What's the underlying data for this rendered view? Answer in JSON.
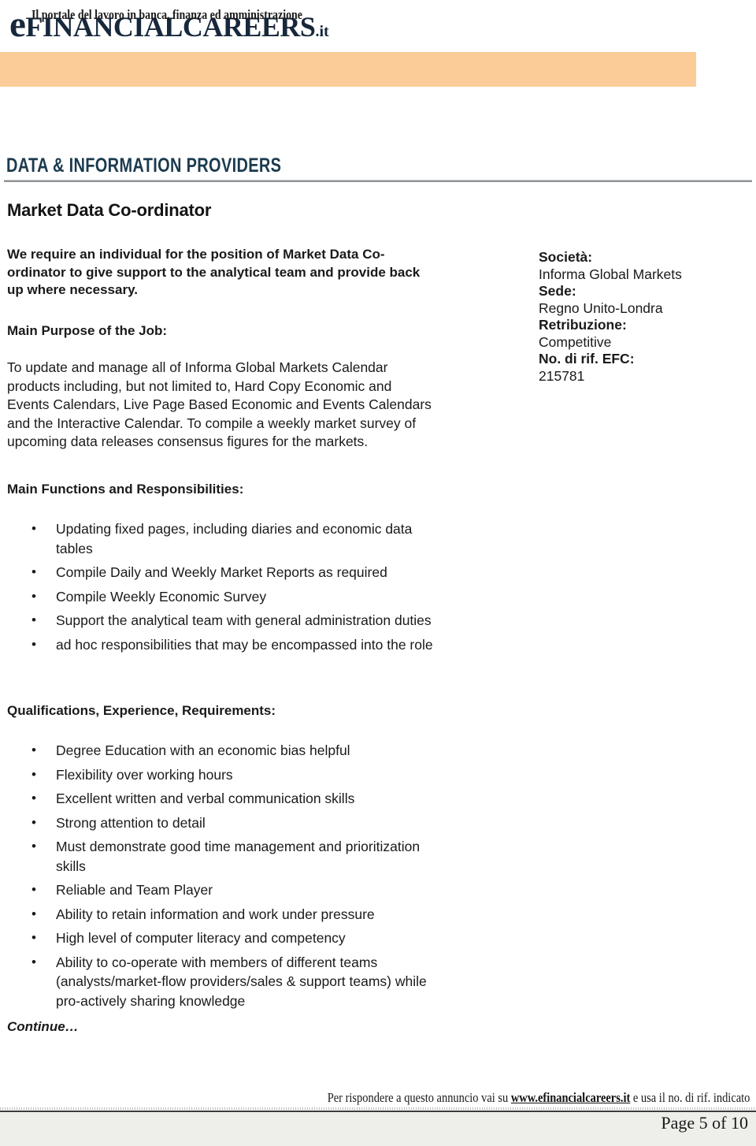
{
  "masthead": {
    "logo": {
      "e": "e",
      "financial": "FINANCIAL",
      "careers": "CAREERS",
      "tld": ".it",
      "color": "#17273c"
    },
    "tagline": "Il portale del lavoro in banca, finanza ed amministrazione",
    "banner_color": "#fbcb98"
  },
  "section": {
    "header": "DATA & INFORMATION PROVIDERS",
    "header_color": "#1b3a4f"
  },
  "job": {
    "title": "Market Data Co-ordinator",
    "intro": "We require an individual for the position of Market Data Co-ordinator to give support to the analytical team and provide back up where necessary.",
    "purpose_heading": "Main Purpose of the Job:",
    "purpose_body": "To update and manage all of Informa Global Markets Calendar products including, but not limited to, Hard Copy Economic and Events Calendars, Live Page Based Economic and Events Calendars and the Interactive Calendar. To compile a weekly market survey of upcoming data releases consensus figures for the markets.",
    "functions_heading": "Main Functions and Responsibilities:",
    "functions": [
      "Updating fixed pages, including diaries and economic data tables",
      "Compile Daily and Weekly Market Reports as required",
      "Compile Weekly Economic Survey",
      "Support the analytical team with general administration duties",
      "ad hoc responsibilities that may be encompassed into the role"
    ],
    "qualifications_heading": "Qualifications, Experience, Requirements:",
    "qualifications": [
      "Degree Education with an economic bias helpful",
      "Flexibility over working hours",
      "Excellent written and verbal communication skills",
      "Strong attention to detail",
      "Must demonstrate good time management and prioritization skills",
      "Reliable and Team Player",
      "Ability to retain information and work under pressure",
      "High level of computer literacy and competency",
      "Ability to co-operate with members of different teams (analysts/market-flow providers/sales & support teams) while pro-actively sharing knowledge"
    ],
    "continue_note": "Continue…",
    "bullet_glyph": "•"
  },
  "details": {
    "company_label": "Società:",
    "company_value": "Informa Global Markets",
    "location_label": "Sede:",
    "location_value": "Regno Unito-Londra",
    "salary_label": "Retribuzione:",
    "salary_value": "Competitive",
    "reference_label": "No. di rif. EFC:",
    "reference_value": "215781"
  },
  "footer": {
    "note_before": "Per rispondere a questo annuncio vai su ",
    "url": "www.efinancialcareers.it",
    "note_after": " e usa il no. di rif. indicato",
    "page_number": "Page 5 of 10"
  }
}
